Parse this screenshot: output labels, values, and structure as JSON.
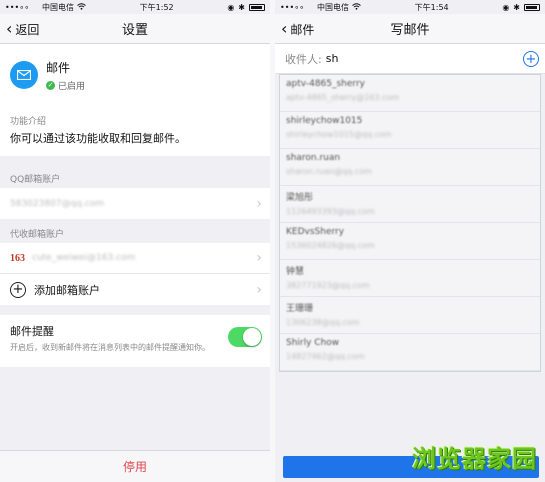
{
  "left": {
    "status": {
      "signal": "•••∘∘",
      "carrier": "中国电信",
      "time": "下午1:52"
    },
    "nav": {
      "back": "返回",
      "title": "设置"
    },
    "account": {
      "name": "邮件",
      "status": "已启用"
    },
    "intro": {
      "label": "功能介绍",
      "text": "你可以通过该功能收取和回复邮件。"
    },
    "qq": {
      "label": "QQ邮箱账户",
      "value": "583023807@qq.com"
    },
    "other": {
      "label": "代收邮箱账户",
      "logo": "163",
      "value": "cute_weiwei@163.com",
      "add": "添加邮箱账户"
    },
    "notify": {
      "title": "邮件提醒",
      "desc": "开启后，收到新邮件将在消息列表中的邮件提醒通知你。",
      "enabled": true
    },
    "disable": "停用"
  },
  "right": {
    "status": {
      "signal": "•••∘∘",
      "carrier": "中国电信",
      "time": "下午1:54"
    },
    "nav": {
      "back": "邮件",
      "title": "写邮件"
    },
    "recipient": {
      "label": "收件人:",
      "value": "sh"
    },
    "suggestions": [
      {
        "name": "aptv-4865_sherry",
        "email": "aptv-4865_sherry@163.com"
      },
      {
        "name": "shirleychow1015",
        "email": "shirleychow1015@qq.com"
      },
      {
        "name": "sharon.ruan",
        "email": "sharon.ruan@qq.com"
      },
      {
        "name": "梁旭彤",
        "email": "1126493393@qq.com"
      },
      {
        "name": "KEDvsSherry",
        "email": "1536024826@qq.com"
      },
      {
        "name": "钟慧",
        "email": "382771923@qq.com"
      },
      {
        "name": "王珊珊",
        "email": "1306238@qq.com"
      },
      {
        "name": "Shirly Chow",
        "email": "14827462@qq.com"
      }
    ],
    "watermark": "浏览器家园"
  }
}
